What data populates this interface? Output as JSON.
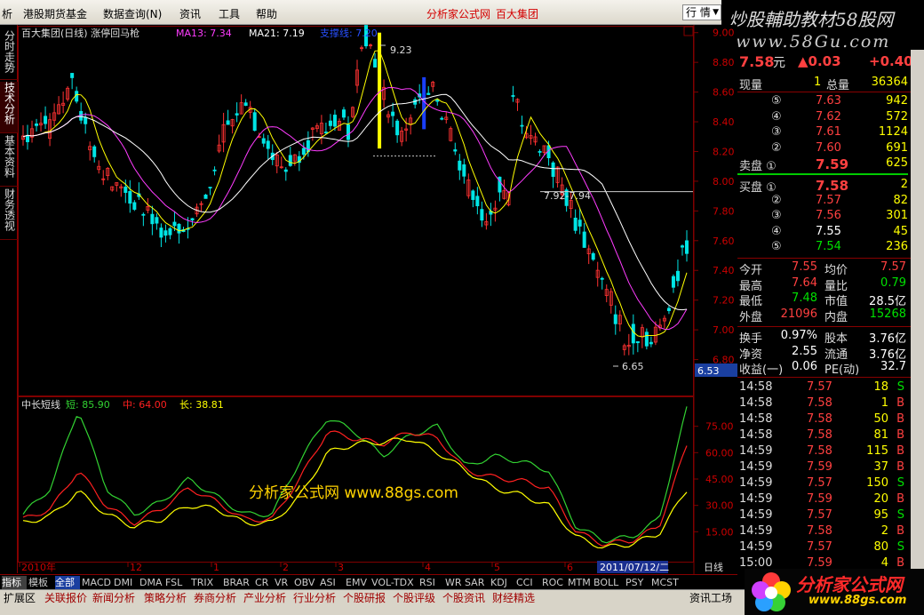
{
  "menubar": {
    "items": [
      "析",
      "港股期货基金",
      "数据查询(N)",
      "资讯",
      "工具",
      "帮助"
    ],
    "promo1": "分析家公式网",
    "promo2": "百大集团",
    "dropdown": "行 情"
  },
  "banner": {
    "line1": "炒股輔助教材58股网",
    "line2": "www.58Gu.com"
  },
  "left_tabs": [
    "分时走势",
    "技术分析",
    "基本资料",
    "财务透视"
  ],
  "main_chart": {
    "title": "百大集团(日线) 涨停回马枪",
    "ma13_label": "MA13: 7.34",
    "ma21_label": "MA21: 7.19",
    "extra_label": "支撑线: 7.20",
    "high_label": "9.23",
    "low_label": "6.65",
    "range_label": "7.92-7.94",
    "current_price_tag": "6.53",
    "y_ticks": [
      "9.00",
      "8.80",
      "8.60",
      "8.40",
      "8.20",
      "8.00",
      "7.80",
      "7.60",
      "7.40",
      "7.20",
      "7.00",
      "6.80"
    ]
  },
  "sub_chart": {
    "title": "中长短线",
    "short_label": "短: 85.90",
    "mid_label": "中: 64.00",
    "long_label": "长: 38.81",
    "y_ticks": [
      "75.00",
      "60.00",
      "45.00",
      "30.00",
      "15.00"
    ],
    "watermark": "分析家公式网 www.88gs.com"
  },
  "time_axis": {
    "labels": [
      "2010年",
      "12",
      "1",
      "2",
      "3",
      "4",
      "5",
      "6"
    ],
    "cursor_date": "2011/07/12/二",
    "period": "日线"
  },
  "quote": {
    "price": "7.58",
    "unit": "元",
    "change": "▲0.03",
    "change_pct": "+0.40",
    "volume_label": "现量",
    "volume": "1",
    "total_label": "总量",
    "total": "36364",
    "sells": [
      {
        "n": "⑤",
        "p": "7.63",
        "v": "942"
      },
      {
        "n": "④",
        "p": "7.62",
        "v": "572"
      },
      {
        "n": "③",
        "p": "7.61",
        "v": "1124"
      },
      {
        "n": "②",
        "p": "7.60",
        "v": "691"
      },
      {
        "n": "卖盘 ①",
        "p": "7.59",
        "v": "625"
      }
    ],
    "buys": [
      {
        "n": "买盘 ①",
        "p": "7.58",
        "v": "2"
      },
      {
        "n": "②",
        "p": "7.57",
        "v": "82"
      },
      {
        "n": "③",
        "p": "7.56",
        "v": "301"
      },
      {
        "n": "④",
        "p": "7.55",
        "v": "45"
      },
      {
        "n": "⑤",
        "p": "7.54",
        "v": "236"
      }
    ],
    "stats": [
      {
        "l1": "今开",
        "v1": "7.55",
        "l2": "均价",
        "v2": "7.57"
      },
      {
        "l1": "最高",
        "v1": "7.64",
        "l2": "量比",
        "v2": "0.79"
      },
      {
        "l1": "最低",
        "v1": "7.48",
        "l2": "市值",
        "v2": "28.5亿"
      },
      {
        "l1": "外盘",
        "v1": "21096",
        "l2": "内盘",
        "v2": "15268"
      }
    ],
    "stats2": [
      {
        "l1": "换手",
        "v1": "0.97%",
        "l2": "股本",
        "v2": "3.76亿"
      },
      {
        "l1": "净资",
        "v1": "2.55",
        "l2": "流通",
        "v2": "3.76亿"
      },
      {
        "l1": "收益(一)",
        "v1": "0.06",
        "l2": "PE(动)",
        "v2": "32.7"
      }
    ],
    "ticks": [
      {
        "t": "14:58",
        "p": "7.57",
        "v": "18",
        "d": "S"
      },
      {
        "t": "14:58",
        "p": "7.58",
        "v": "1",
        "d": "B"
      },
      {
        "t": "14:58",
        "p": "7.58",
        "v": "50",
        "d": "B"
      },
      {
        "t": "14:58",
        "p": "7.58",
        "v": "81",
        "d": "B"
      },
      {
        "t": "14:59",
        "p": "7.58",
        "v": "115",
        "d": "B"
      },
      {
        "t": "14:59",
        "p": "7.59",
        "v": "37",
        "d": "B"
      },
      {
        "t": "14:59",
        "p": "7.57",
        "v": "150",
        "d": "S"
      },
      {
        "t": "14:59",
        "p": "7.59",
        "v": "20",
        "d": "B"
      },
      {
        "t": "14:59",
        "p": "7.57",
        "v": "95",
        "d": "S"
      },
      {
        "t": "14:59",
        "p": "7.58",
        "v": "2",
        "d": "B"
      },
      {
        "t": "14:59",
        "p": "7.57",
        "v": "80",
        "d": "S"
      },
      {
        "t": "15:00",
        "p": "7.59",
        "v": "4",
        "d": "B"
      }
    ]
  },
  "indicator_tabs": [
    "指标",
    "模板",
    "全部",
    "MACD",
    "DMI",
    "DMA",
    "FSL",
    "TRIX",
    "BRAR",
    "CR",
    "VR",
    "OBV",
    "ASI",
    "EMV",
    "VOL-TDX",
    "RSI",
    "WR",
    "SAR",
    "KDJ",
    "CCI",
    "ROC",
    "MTM",
    "BOLL",
    "PSY",
    "MCST"
  ],
  "bottom_tabs": [
    "扩展区",
    "关联报价",
    "新闻分析",
    "策略分析",
    "券商分析",
    "产业分析",
    "行业分析",
    "个股研报",
    "个股评级",
    "个股资讯",
    "财经精选",
    "资讯工场"
  ],
  "logo": {
    "text": "分析家公式网",
    "url": "www.88gs.com"
  },
  "colors": {
    "up": "#ff3232",
    "down": "#00e5e5",
    "ma13": "#ff3cff",
    "ma21": "#ffffff",
    "short": "#32d232",
    "mid": "#ff2020",
    "long": "#ffff00",
    "grid": "#800000",
    "price_up": "#ff4040",
    "price_down": "#00e000"
  },
  "chart_data": [
    {
      "type": "candlestick",
      "title": "百大集团(日线) 涨停回马枪",
      "ylim": [
        6.6,
        9.1
      ],
      "x": [
        "2010年",
        "12",
        "1",
        "2",
        "3",
        "4",
        "5",
        "6"
      ],
      "series": [
        {
          "name": "MA13",
          "values": [
            7.34
          ]
        },
        {
          "name": "MA21",
          "values": [
            7.19
          ]
        },
        {
          "name": "支撑线",
          "values": [
            7.2
          ]
        }
      ],
      "annotations": [
        "9.23",
        "6.65",
        "7.92-7.94"
      ]
    },
    {
      "type": "line",
      "title": "中长短线",
      "ylim": [
        0,
        90
      ],
      "series": [
        {
          "name": "短",
          "values": [
            25,
            40,
            85,
            40,
            25,
            32,
            45,
            35,
            25,
            25,
            55,
            80,
            72,
            58,
            70,
            75,
            52,
            58,
            55,
            50,
            18,
            10,
            12,
            22,
            85
          ]
        },
        {
          "name": "中",
          "values": [
            22,
            28,
            50,
            30,
            20,
            28,
            40,
            32,
            22,
            22,
            45,
            72,
            68,
            65,
            72,
            68,
            50,
            46,
            44,
            40,
            15,
            8,
            10,
            18,
            64
          ]
        },
        {
          "name": "长",
          "values": [
            20,
            24,
            38,
            25,
            18,
            22,
            30,
            28,
            20,
            20,
            35,
            60,
            65,
            66,
            68,
            60,
            50,
            40,
            36,
            30,
            12,
            6,
            8,
            14,
            38.81
          ]
        }
      ]
    }
  ]
}
